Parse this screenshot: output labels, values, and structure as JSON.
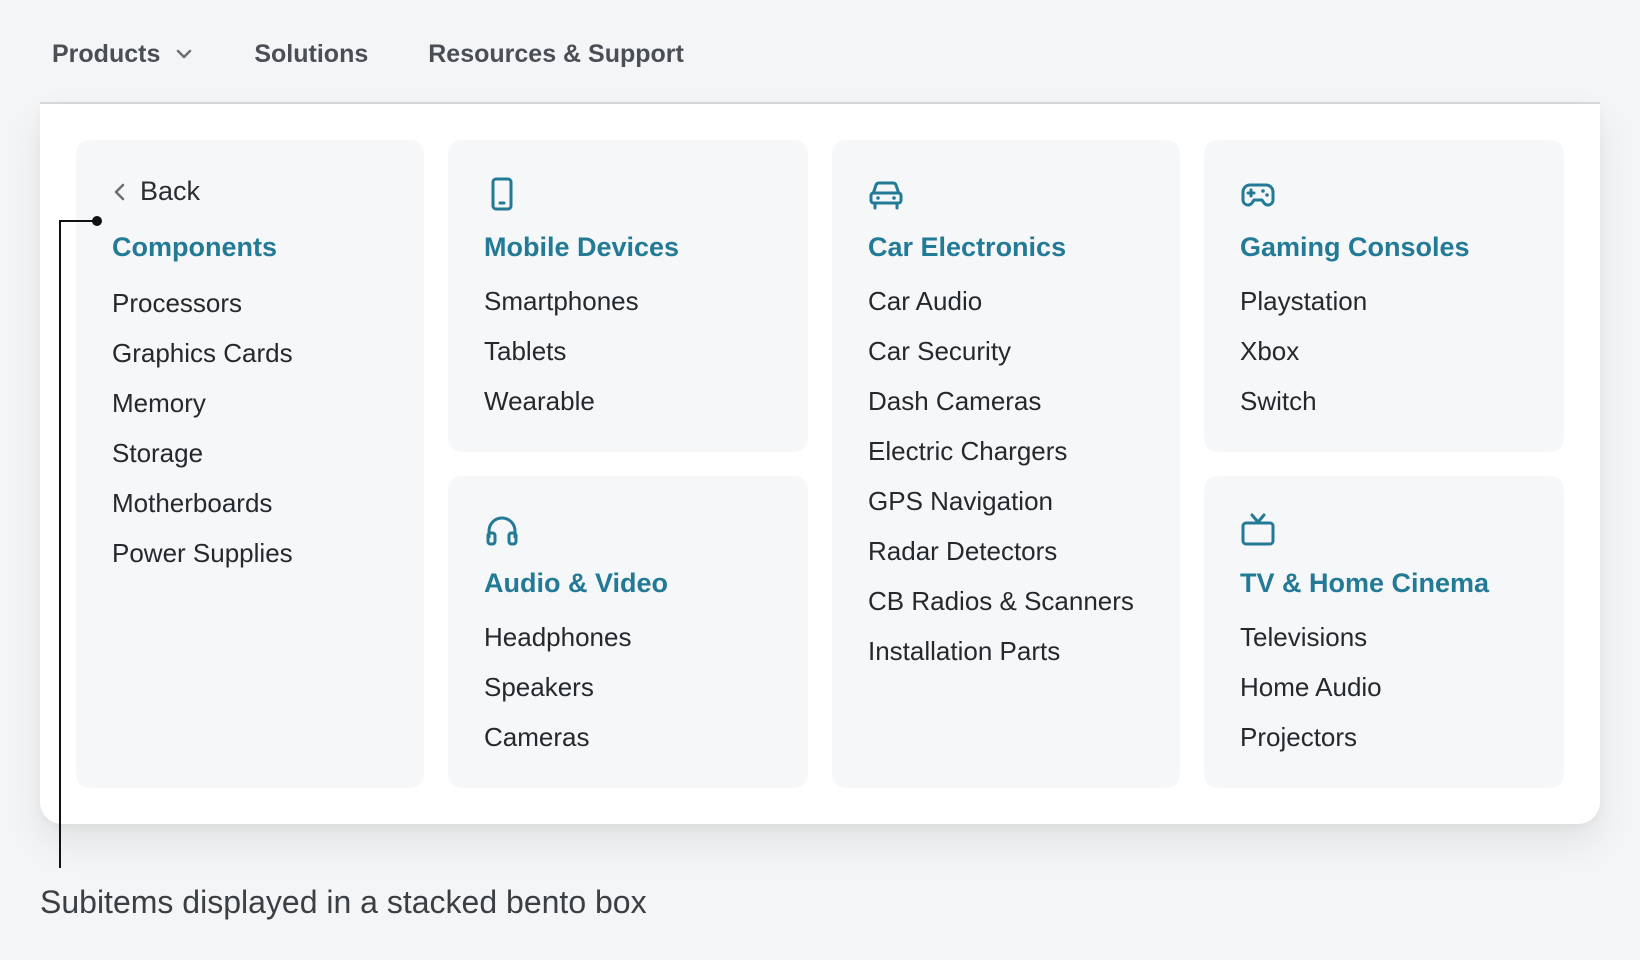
{
  "nav": {
    "items": [
      {
        "label": "Products"
      },
      {
        "label": "Solutions"
      },
      {
        "label": "Resources & Support"
      }
    ]
  },
  "colors": {
    "accent": "#237a96",
    "card_bg": "#f6f7f8",
    "page_bg": "#f4f5f6"
  },
  "menu": {
    "back_label": "Back",
    "components": {
      "title": "Components",
      "items": [
        "Processors",
        "Graphics Cards",
        "Memory",
        "Storage",
        "Motherboards",
        "Power Supplies"
      ]
    },
    "mobile": {
      "icon": "tablet-icon",
      "title": "Mobile Devices",
      "items": [
        "Smartphones",
        "Tablets",
        "Wearable"
      ]
    },
    "audio": {
      "icon": "headphones-icon",
      "title": "Audio & Video",
      "items": [
        "Headphones",
        "Speakers",
        "Cameras"
      ]
    },
    "car": {
      "icon": "car-icon",
      "title": "Car Electronics",
      "items": [
        "Car Audio",
        "Car Security",
        "Dash Cameras",
        "Electric Chargers",
        "GPS Navigation",
        "Radar Detectors",
        "CB Radios & Scanners",
        "Installation Parts"
      ]
    },
    "gaming": {
      "icon": "gamepad-icon",
      "title": "Gaming Consoles",
      "items": [
        "Playstation",
        "Xbox",
        "Switch"
      ]
    },
    "tv": {
      "icon": "tv-icon",
      "title": "TV & Home Cinema",
      "items": [
        "Televisions",
        "Home Audio",
        "Projectors"
      ]
    }
  },
  "annotation": {
    "caption": "Subitems displayed in a stacked bento box"
  }
}
